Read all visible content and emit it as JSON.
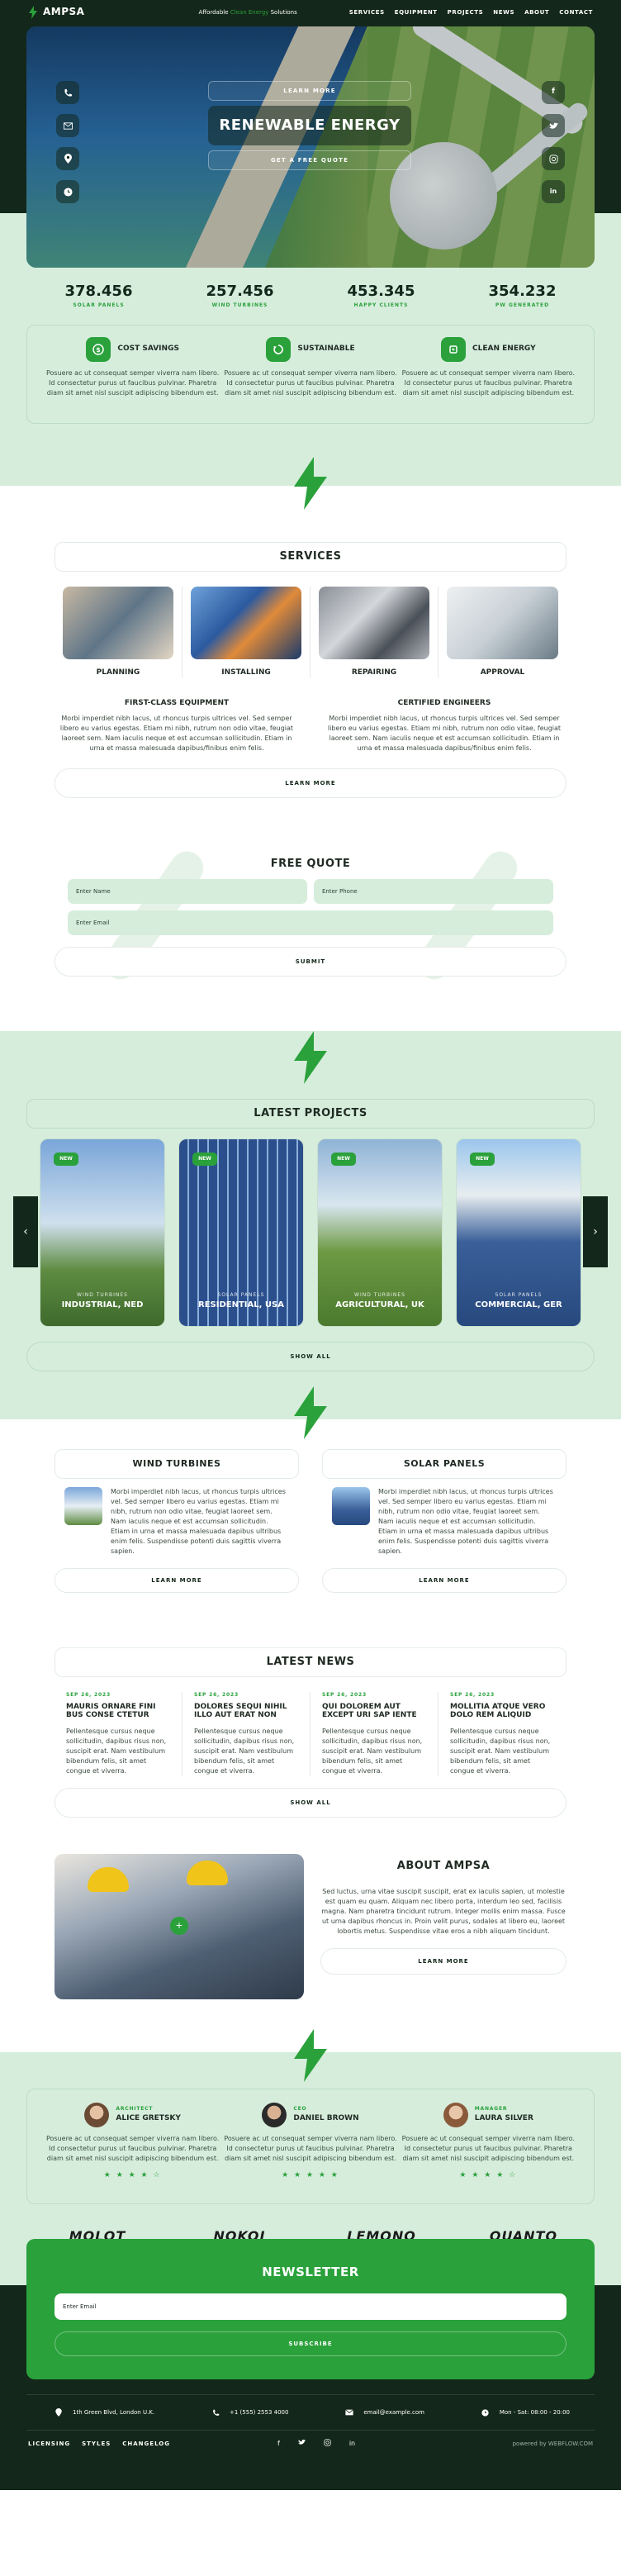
{
  "nav": {
    "brand": "AMPSA",
    "tagline_pre": "Affordable ",
    "tagline_accent": "Clean Energy",
    "tagline_post": " Solutions",
    "menu": [
      "SERVICES",
      "EQUIPMENT",
      "PROJECTS",
      "NEWS",
      "ABOUT",
      "CONTACT"
    ]
  },
  "hero": {
    "learn_more": "LEARN MORE",
    "title": "RENEWABLE ENERGY",
    "quote": "GET A FREE QUOTE"
  },
  "stats": [
    {
      "value": "378.456",
      "label": "SOLAR PANELS"
    },
    {
      "value": "257.456",
      "label": "WIND TURBINES"
    },
    {
      "value": "453.345",
      "label": "HAPPY CLIENTS"
    },
    {
      "value": "354.232",
      "label": "PW GENERATED"
    }
  ],
  "features": [
    {
      "title": "COST SAVINGS",
      "text": "Posuere ac ut consequat semper viverra nam libero. Id consectetur purus ut faucibus pulvinar. Pharetra diam sit amet nisl suscipit adipiscing bibendum est."
    },
    {
      "title": "SUSTAINABLE",
      "text": "Posuere ac ut consequat semper viverra nam libero. Id consectetur purus ut faucibus pulvinar. Pharetra diam sit amet nisl suscipit adipiscing bibendum est."
    },
    {
      "title": "CLEAN ENERGY",
      "text": "Posuere ac ut consequat semper viverra nam libero. Id consectetur purus ut faucibus pulvinar. Pharetra diam sit amet nisl suscipit adipiscing bibendum est."
    }
  ],
  "services": {
    "title": "SERVICES",
    "items": [
      "PLANNING",
      "INSTALLING",
      "REPAIRING",
      "APPROVAL"
    ],
    "col1_title": "FIRST-CLASS EQUIPMENT",
    "col2_title": "CERTIFIED ENGINEERS",
    "col1_text": "Morbi imperdiet nibh lacus, ut rhoncus turpis ultrices vel. Sed semper libero eu varius egestas. Etiam mi nibh, rutrum non odio vitae, feugiat laoreet sem. Nam iaculis neque et est accumsan sollicitudin. Etiam in urna et massa malesuada dapibus/finibus enim felis.",
    "col2_text": "Morbi imperdiet nibh lacus, ut rhoncus turpis ultrices vel. Sed semper libero eu varius egestas. Etiam mi nibh, rutrum non odio vitae, feugiat laoreet sem. Nam iaculis neque et est accumsan sollicitudin. Etiam in urna et massa malesuada dapibus/finibus enim felis.",
    "learn_more": "LEARN MORE"
  },
  "quote": {
    "title": "FREE QUOTE",
    "name_ph": "Enter Name",
    "phone_ph": "Enter Phone",
    "email_ph": "Enter Email",
    "submit": "SUBMIT"
  },
  "projects": {
    "title": "LATEST PROJECTS",
    "show_all": "SHOW ALL",
    "badge": "NEW",
    "items": [
      {
        "type": "WIND TURBINES",
        "name": "INDUSTRIAL, NED"
      },
      {
        "type": "SOLAR PANELS",
        "name": "RESIDENTIAL, USA"
      },
      {
        "type": "WIND TURBINES",
        "name": "AGRICULTURAL, UK"
      },
      {
        "type": "SOLAR PANELS",
        "name": "COMMERCIAL, GER"
      }
    ]
  },
  "equipment": [
    {
      "title": "WIND TURBINES",
      "text": "Morbi imperdiet nibh lacus, ut rhoncus turpis ultrices vel. Sed semper libero eu varius egestas. Etiam mi nibh, rutrum non odio vitae, feugiat laoreet sem. Nam iaculis neque et est accumsan sollicitudin. Etiam in urna et massa malesuada dapibus ultribus enim felis. Suspendisse potenti duis sagittis viverra sapien.",
      "btn": "LEARN MORE"
    },
    {
      "title": "SOLAR PANELS",
      "text": "Morbi imperdiet nibh lacus, ut rhoncus turpis ultrices vel. Sed semper libero eu varius egestas. Etiam mi nibh, rutrum non odio vitae, feugiat laoreet sem. Nam iaculis neque et est accumsan sollicitudin. Etiam in urna et massa malesuada dapibus ultribus enim felis. Suspendisse potenti duis sagittis viverra sapien.",
      "btn": "LEARN MORE"
    }
  ],
  "news": {
    "title": "LATEST NEWS",
    "show_all": "SHOW ALL",
    "items": [
      {
        "date": "SEP 26, 2023",
        "title": "MAURIS ORNARE FINI BUS CONSE CTETUR",
        "text": "Pellentesque cursus neque sollicitudin, dapibus risus non, suscipit erat. Nam vestibulum bibendum felis, sit amet congue et viverra."
      },
      {
        "date": "SEP 26, 2023",
        "title": "DOLORES SEQUI NIHIL ILLO AUT ERAT NON",
        "text": "Pellentesque cursus neque sollicitudin, dapibus risus non, suscipit erat. Nam vestibulum bibendum felis, sit amet congue et viverra."
      },
      {
        "date": "SEP 26, 2023",
        "title": "QUI DOLOREM AUT EXCEPT URI SAP IENTE",
        "text": "Pellentesque cursus neque sollicitudin, dapibus risus non, suscipit erat. Nam vestibulum bibendum felis, sit amet congue et viverra."
      },
      {
        "date": "SEP 26, 2023",
        "title": "MOLLITIA ATQUE VERO DOLO REM ALIQUID",
        "text": "Pellentesque cursus neque sollicitudin, dapibus risus non, suscipit erat. Nam vestibulum bibendum felis, sit amet congue et viverra."
      }
    ]
  },
  "about": {
    "title": "ABOUT AMPSA",
    "text": "Sed luctus, urna vitae suscipit suscipit, erat ex iaculis sapien, ut molestie est quam eu quam. Aliquam nec libero porta, interdum leo sed, facilisis magna. Nam pharetra tincidunt rutrum. Integer mollis enim massa. Fusce ut urna dapibus rhoncus in. Proin velit purus, sodales at libero eu, laoreet lobortis metus. Suspendisse vitae eros a nibh aliquam tincidunt.",
    "btn": "LEARN MORE"
  },
  "team": [
    {
      "role": "ARCHITECT",
      "name": "ALICE GRETSKY",
      "text": "Posuere ac ut consequat semper viverra nam libero. Id consectetur purus ut faucibus pulvinar. Pharetra diam sit amet nisl suscipit adipiscing bibendum est.",
      "stars": "★ ★ ★ ★ ☆"
    },
    {
      "role": "CEO",
      "name": "DANIEL BROWN",
      "text": "Posuere ac ut consequat semper viverra nam libero. Id consectetur purus ut faucibus pulvinar. Pharetra diam sit amet nisl suscipit adipiscing bibendum est.",
      "stars": "★ ★ ★ ★ ★"
    },
    {
      "role": "MANAGER",
      "name": "LAURA SILVER",
      "text": "Posuere ac ut consequat semper viverra nam libero. Id consectetur purus ut faucibus pulvinar. Pharetra diam sit amet nisl suscipit adipiscing bibendum est.",
      "stars": "★ ★ ★ ★ ☆"
    }
  ],
  "brands": [
    "MOLOT",
    "NOKOI",
    "LEMONO",
    "QUANTO"
  ],
  "newsletter": {
    "title": "NEWSLETTER",
    "email_ph": "Enter Email",
    "subscribe": "SUBSCRIBE"
  },
  "footer": {
    "address": "1th Green Blvd, London U.K.",
    "phone": "+1 (555) 2553 4000",
    "email": "email@example.com",
    "hours": "Mon - Sat: 08:00 - 20:00",
    "links": [
      "LICENSING",
      "STYLES",
      "CHANGELOG"
    ],
    "powered": "powered by WEBFLOW.COM"
  },
  "colors": {
    "accent": "#2aa13b",
    "dark": "#13271a",
    "mint": "#d6eddc"
  }
}
